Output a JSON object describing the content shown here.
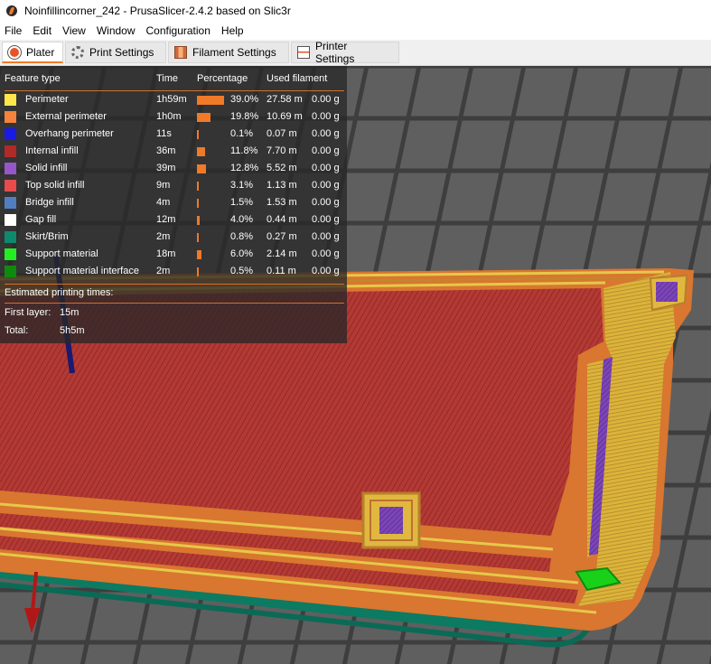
{
  "window": {
    "title": "Noinfillincorner_242 - PrusaSlicer-2.4.2 based on Slic3r"
  },
  "menu": [
    "File",
    "Edit",
    "View",
    "Window",
    "Configuration",
    "Help"
  ],
  "tabs": [
    {
      "label": "Plater",
      "icon": "plater-icon",
      "active": true
    },
    {
      "label": "Print Settings",
      "icon": "print-settings-icon"
    },
    {
      "label": "Filament Settings",
      "icon": "filament-icon"
    },
    {
      "label": "Printer Settings",
      "icon": "printer-icon"
    }
  ],
  "legend": {
    "headers": {
      "feature": "Feature type",
      "time": "Time",
      "percentage": "Percentage",
      "filament": "Used filament"
    },
    "rows": [
      {
        "name": "Perimeter",
        "color": "#ffe64d",
        "time": "1h59m",
        "pct": "39.0%",
        "pct_value": 39.0,
        "length": "27.58 m",
        "weight": "0.00 g"
      },
      {
        "name": "External perimeter",
        "color": "#f5833b",
        "time": "1h0m",
        "pct": "19.8%",
        "pct_value": 19.8,
        "length": "10.69 m",
        "weight": "0.00 g"
      },
      {
        "name": "Overhang perimeter",
        "color": "#1a1ae6",
        "time": "11s",
        "pct": "0.1%",
        "pct_value": 0.1,
        "length": "0.07 m",
        "weight": "0.00 g"
      },
      {
        "name": "Internal infill",
        "color": "#b02a2a",
        "time": "36m",
        "pct": "11.8%",
        "pct_value": 11.8,
        "length": "7.70 m",
        "weight": "0.00 g"
      },
      {
        "name": "Solid infill",
        "color": "#9656c8",
        "time": "39m",
        "pct": "12.8%",
        "pct_value": 12.8,
        "length": "5.52 m",
        "weight": "0.00 g"
      },
      {
        "name": "Top solid infill",
        "color": "#e84b4b",
        "time": "9m",
        "pct": "3.1%",
        "pct_value": 3.1,
        "length": "1.13 m",
        "weight": "0.00 g"
      },
      {
        "name": "Bridge infill",
        "color": "#4f7fc0",
        "time": "4m",
        "pct": "1.5%",
        "pct_value": 1.5,
        "length": "1.53 m",
        "weight": "0.00 g"
      },
      {
        "name": "Gap fill",
        "color": "#ffffff",
        "time": "12m",
        "pct": "4.0%",
        "pct_value": 4.0,
        "length": "0.44 m",
        "weight": "0.00 g"
      },
      {
        "name": "Skirt/Brim",
        "color": "#0d8a6c",
        "time": "2m",
        "pct": "0.8%",
        "pct_value": 0.8,
        "length": "0.27 m",
        "weight": "0.00 g"
      },
      {
        "name": "Support material",
        "color": "#22ee22",
        "time": "18m",
        "pct": "6.0%",
        "pct_value": 6.0,
        "length": "2.14 m",
        "weight": "0.00 g"
      },
      {
        "name": "Support material interface",
        "color": "#0f8a0f",
        "time": "2m",
        "pct": "0.5%",
        "pct_value": 0.5,
        "length": "0.11 m",
        "weight": "0.00 g"
      }
    ],
    "estimated_title": "Estimated printing times:",
    "first_layer_label": "First layer:",
    "first_layer_value": "15m",
    "total_label": "Total:",
    "total_value": "5h5m"
  }
}
